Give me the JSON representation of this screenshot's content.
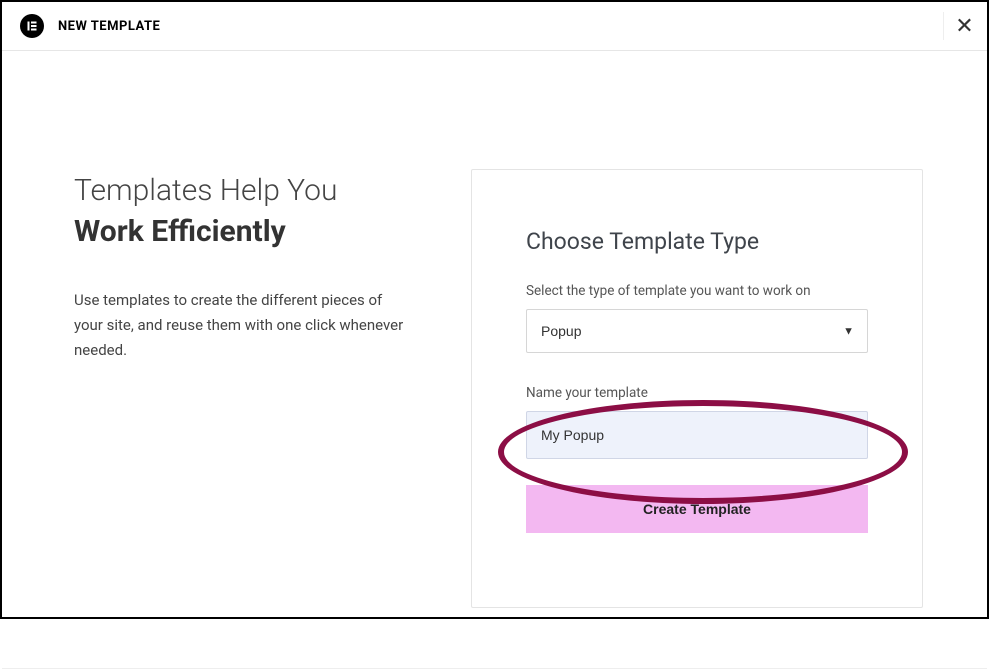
{
  "header": {
    "title": "NEW TEMPLATE"
  },
  "left": {
    "heading_line1": "Templates Help You",
    "heading_line2": "Work Efficiently",
    "paragraph": "Use templates to create the different pieces of your site, and reuse them with one click whenever needed."
  },
  "panel": {
    "title": "Choose Template Type",
    "type_label": "Select the type of template you want to work on",
    "type_value": "Popup",
    "name_label": "Name your template",
    "name_value": "My Popup",
    "create_button": "Create Template"
  }
}
